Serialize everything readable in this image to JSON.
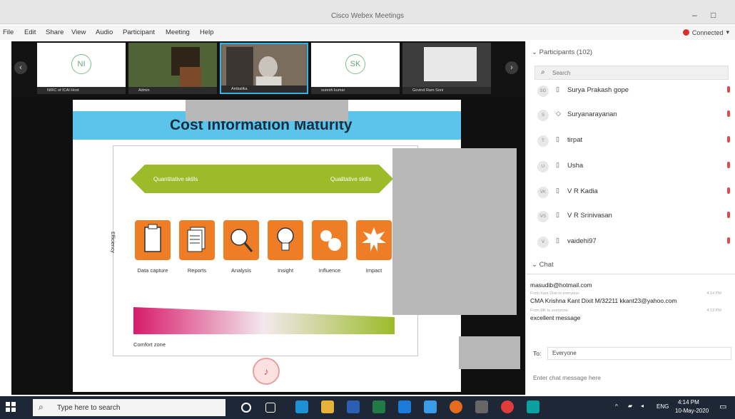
{
  "window": {
    "title": "Cisco Webex Meetings",
    "controls": {
      "minimize": "–",
      "maximize": "□"
    }
  },
  "menu": {
    "items": [
      "File",
      "Edit",
      "Share",
      "View",
      "Audio",
      "Participant",
      "Meeting",
      "Help"
    ],
    "status": "Connected"
  },
  "video_strip": {
    "tiles": [
      {
        "initials": "NI",
        "caption": "NIRC of ICAI Host"
      },
      {
        "initials": "",
        "caption": "Admin"
      },
      {
        "initials": "",
        "caption": "Ambalika"
      },
      {
        "initials": "SK",
        "caption": "suresh kumar"
      },
      {
        "initials": "",
        "caption": "Govind Ram Soni"
      }
    ],
    "prev": "‹",
    "next": "›"
  },
  "slide": {
    "title": "Cost information Maturity",
    "arrow_left_label": "Quantitative skills",
    "arrow_right_label": "Qualitative skills",
    "vertical_label": "Efficiency",
    "tiles": [
      "Data capture",
      "Reports",
      "Analysis",
      "Insight",
      "Influence",
      "Impact"
    ],
    "tile_icons": [
      "clipboard-icon",
      "documents-icon",
      "magnifier-icon",
      "lightbulb-icon",
      "influence-icon",
      "impact-icon"
    ],
    "bottom_label": "Comfort zone",
    "colors": {
      "header": "#5ac4ea",
      "tile": "#ee7d25",
      "arrow": "#9cbb2a"
    }
  },
  "participants": {
    "header": "Participants (102)",
    "search_placeholder": "Search",
    "list": [
      {
        "initials": "SG",
        "name": "Surya Prakash gope"
      },
      {
        "initials": "S",
        "name": "Suryanarayanan"
      },
      {
        "initials": "T",
        "name": "tirpat"
      },
      {
        "initials": "U",
        "name": "Usha"
      },
      {
        "initials": "VK",
        "name": "V R Kadia"
      },
      {
        "initials": "VS",
        "name": "V R Srinivasan"
      },
      {
        "initials": "V",
        "name": "vaidehi97"
      }
    ]
  },
  "chat": {
    "header": "Chat",
    "messages": [
      {
        "from": "",
        "time": "",
        "text": "masudib@hotmail.com"
      },
      {
        "from": "From Kant Dixit to everyone:",
        "time": "4:14 PM",
        "text": "CMA Krishna Kant Dixit M/32211 kkant23@yahoo.com"
      },
      {
        "from": "From MF to everyone:",
        "time": "4:13 PM",
        "text": "excellent message"
      }
    ],
    "to_label": "To:",
    "to_value": "Everyone",
    "input_placeholder": "Enter chat message here"
  },
  "taskbar": {
    "search_placeholder": "Type here to search",
    "lang": "ENG",
    "time": "4:14 PM",
    "date": "10-May-2020"
  }
}
